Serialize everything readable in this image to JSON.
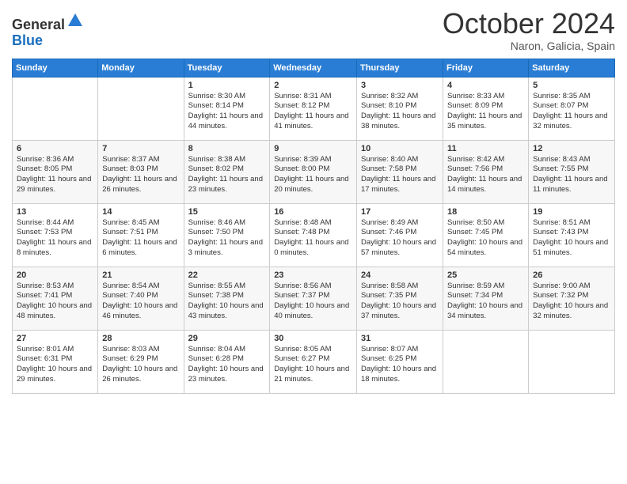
{
  "header": {
    "logo_line1": "General",
    "logo_line2": "Blue",
    "month": "October 2024",
    "location": "Naron, Galicia, Spain"
  },
  "weekdays": [
    "Sunday",
    "Monday",
    "Tuesday",
    "Wednesday",
    "Thursday",
    "Friday",
    "Saturday"
  ],
  "weeks": [
    [
      {
        "day": "",
        "sunrise": "",
        "sunset": "",
        "daylight": ""
      },
      {
        "day": "",
        "sunrise": "",
        "sunset": "",
        "daylight": ""
      },
      {
        "day": "1",
        "sunrise": "Sunrise: 8:30 AM",
        "sunset": "Sunset: 8:14 PM",
        "daylight": "Daylight: 11 hours and 44 minutes."
      },
      {
        "day": "2",
        "sunrise": "Sunrise: 8:31 AM",
        "sunset": "Sunset: 8:12 PM",
        "daylight": "Daylight: 11 hours and 41 minutes."
      },
      {
        "day": "3",
        "sunrise": "Sunrise: 8:32 AM",
        "sunset": "Sunset: 8:10 PM",
        "daylight": "Daylight: 11 hours and 38 minutes."
      },
      {
        "day": "4",
        "sunrise": "Sunrise: 8:33 AM",
        "sunset": "Sunset: 8:09 PM",
        "daylight": "Daylight: 11 hours and 35 minutes."
      },
      {
        "day": "5",
        "sunrise": "Sunrise: 8:35 AM",
        "sunset": "Sunset: 8:07 PM",
        "daylight": "Daylight: 11 hours and 32 minutes."
      }
    ],
    [
      {
        "day": "6",
        "sunrise": "Sunrise: 8:36 AM",
        "sunset": "Sunset: 8:05 PM",
        "daylight": "Daylight: 11 hours and 29 minutes."
      },
      {
        "day": "7",
        "sunrise": "Sunrise: 8:37 AM",
        "sunset": "Sunset: 8:03 PM",
        "daylight": "Daylight: 11 hours and 26 minutes."
      },
      {
        "day": "8",
        "sunrise": "Sunrise: 8:38 AM",
        "sunset": "Sunset: 8:02 PM",
        "daylight": "Daylight: 11 hours and 23 minutes."
      },
      {
        "day": "9",
        "sunrise": "Sunrise: 8:39 AM",
        "sunset": "Sunset: 8:00 PM",
        "daylight": "Daylight: 11 hours and 20 minutes."
      },
      {
        "day": "10",
        "sunrise": "Sunrise: 8:40 AM",
        "sunset": "Sunset: 7:58 PM",
        "daylight": "Daylight: 11 hours and 17 minutes."
      },
      {
        "day": "11",
        "sunrise": "Sunrise: 8:42 AM",
        "sunset": "Sunset: 7:56 PM",
        "daylight": "Daylight: 11 hours and 14 minutes."
      },
      {
        "day": "12",
        "sunrise": "Sunrise: 8:43 AM",
        "sunset": "Sunset: 7:55 PM",
        "daylight": "Daylight: 11 hours and 11 minutes."
      }
    ],
    [
      {
        "day": "13",
        "sunrise": "Sunrise: 8:44 AM",
        "sunset": "Sunset: 7:53 PM",
        "daylight": "Daylight: 11 hours and 8 minutes."
      },
      {
        "day": "14",
        "sunrise": "Sunrise: 8:45 AM",
        "sunset": "Sunset: 7:51 PM",
        "daylight": "Daylight: 11 hours and 6 minutes."
      },
      {
        "day": "15",
        "sunrise": "Sunrise: 8:46 AM",
        "sunset": "Sunset: 7:50 PM",
        "daylight": "Daylight: 11 hours and 3 minutes."
      },
      {
        "day": "16",
        "sunrise": "Sunrise: 8:48 AM",
        "sunset": "Sunset: 7:48 PM",
        "daylight": "Daylight: 11 hours and 0 minutes."
      },
      {
        "day": "17",
        "sunrise": "Sunrise: 8:49 AM",
        "sunset": "Sunset: 7:46 PM",
        "daylight": "Daylight: 10 hours and 57 minutes."
      },
      {
        "day": "18",
        "sunrise": "Sunrise: 8:50 AM",
        "sunset": "Sunset: 7:45 PM",
        "daylight": "Daylight: 10 hours and 54 minutes."
      },
      {
        "day": "19",
        "sunrise": "Sunrise: 8:51 AM",
        "sunset": "Sunset: 7:43 PM",
        "daylight": "Daylight: 10 hours and 51 minutes."
      }
    ],
    [
      {
        "day": "20",
        "sunrise": "Sunrise: 8:53 AM",
        "sunset": "Sunset: 7:41 PM",
        "daylight": "Daylight: 10 hours and 48 minutes."
      },
      {
        "day": "21",
        "sunrise": "Sunrise: 8:54 AM",
        "sunset": "Sunset: 7:40 PM",
        "daylight": "Daylight: 10 hours and 46 minutes."
      },
      {
        "day": "22",
        "sunrise": "Sunrise: 8:55 AM",
        "sunset": "Sunset: 7:38 PM",
        "daylight": "Daylight: 10 hours and 43 minutes."
      },
      {
        "day": "23",
        "sunrise": "Sunrise: 8:56 AM",
        "sunset": "Sunset: 7:37 PM",
        "daylight": "Daylight: 10 hours and 40 minutes."
      },
      {
        "day": "24",
        "sunrise": "Sunrise: 8:58 AM",
        "sunset": "Sunset: 7:35 PM",
        "daylight": "Daylight: 10 hours and 37 minutes."
      },
      {
        "day": "25",
        "sunrise": "Sunrise: 8:59 AM",
        "sunset": "Sunset: 7:34 PM",
        "daylight": "Daylight: 10 hours and 34 minutes."
      },
      {
        "day": "26",
        "sunrise": "Sunrise: 9:00 AM",
        "sunset": "Sunset: 7:32 PM",
        "daylight": "Daylight: 10 hours and 32 minutes."
      }
    ],
    [
      {
        "day": "27",
        "sunrise": "Sunrise: 8:01 AM",
        "sunset": "Sunset: 6:31 PM",
        "daylight": "Daylight: 10 hours and 29 minutes."
      },
      {
        "day": "28",
        "sunrise": "Sunrise: 8:03 AM",
        "sunset": "Sunset: 6:29 PM",
        "daylight": "Daylight: 10 hours and 26 minutes."
      },
      {
        "day": "29",
        "sunrise": "Sunrise: 8:04 AM",
        "sunset": "Sunset: 6:28 PM",
        "daylight": "Daylight: 10 hours and 23 minutes."
      },
      {
        "day": "30",
        "sunrise": "Sunrise: 8:05 AM",
        "sunset": "Sunset: 6:27 PM",
        "daylight": "Daylight: 10 hours and 21 minutes."
      },
      {
        "day": "31",
        "sunrise": "Sunrise: 8:07 AM",
        "sunset": "Sunset: 6:25 PM",
        "daylight": "Daylight: 10 hours and 18 minutes."
      },
      {
        "day": "",
        "sunrise": "",
        "sunset": "",
        "daylight": ""
      },
      {
        "day": "",
        "sunrise": "",
        "sunset": "",
        "daylight": ""
      }
    ]
  ]
}
